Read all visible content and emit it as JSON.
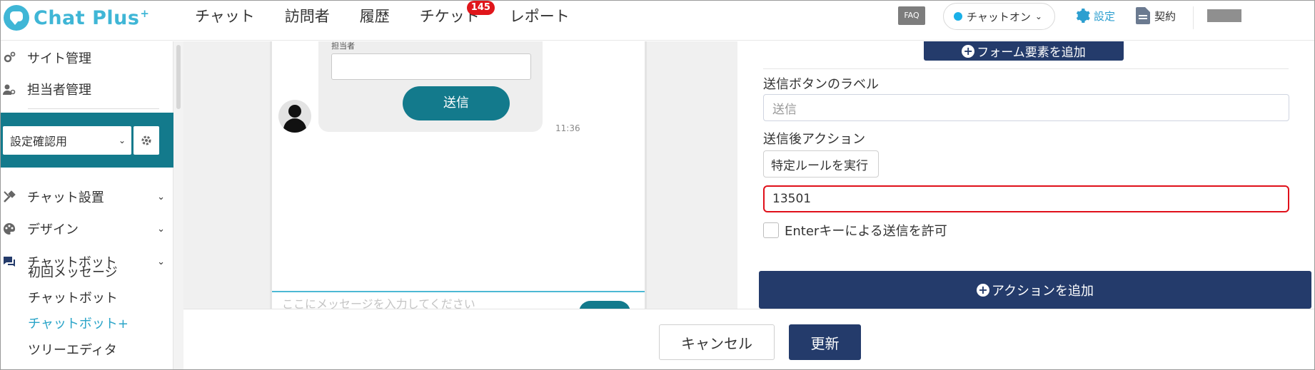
{
  "app": {
    "logo_text": "Chat Plus",
    "logo_plus": "+",
    "brand_color": "#3fb6d6",
    "accent_color": "#243b6b",
    "teal_color": "#137a8c"
  },
  "header": {
    "nav": [
      {
        "label": "チャット"
      },
      {
        "label": "訪問者"
      },
      {
        "label": "履歴"
      },
      {
        "label": "チケット",
        "badge": "145"
      },
      {
        "label": "レポート"
      }
    ],
    "faq_label": "FAQ",
    "status": {
      "label": "チャットオン",
      "dot_color": "#1ab0e8"
    },
    "settings_label": "設定",
    "contract_label": "契約"
  },
  "sidebar": {
    "items_top": [
      {
        "label": "サイト管理",
        "icon": "gears-icon"
      },
      {
        "label": "担当者管理",
        "icon": "user-gear-icon"
      }
    ],
    "site_select": {
      "value": "設定確認用"
    },
    "sections": [
      {
        "label": "チャット設置",
        "icon": "tools-icon"
      },
      {
        "label": "デザイン",
        "icon": "palette-icon"
      },
      {
        "label": "チャットボット",
        "icon": "chat-icon"
      }
    ],
    "sub_items": [
      {
        "label": "初回メッセージ",
        "active": false
      },
      {
        "label": "チャットボット",
        "active": false
      },
      {
        "label": "チャットボット+",
        "active": true
      },
      {
        "label": "ツリーエディタ",
        "active": false
      }
    ]
  },
  "preview": {
    "field_label": "担当者",
    "send_button": "送信",
    "time": "11:36",
    "composer_placeholder": "ここにメッセージを入力してください"
  },
  "panel": {
    "add_form_element": "フォーム要素を追加",
    "send_label_title": "送信ボタンのラベル",
    "send_label_value": "送信",
    "after_action_title": "送信後アクション",
    "after_action_value": "特定ルールを実行",
    "rule_id_value": "13501",
    "enter_key_label": "Enterキーによる送信を許可",
    "add_action": "アクションを追加"
  },
  "footer": {
    "cancel": "キャンセル",
    "update": "更新"
  }
}
